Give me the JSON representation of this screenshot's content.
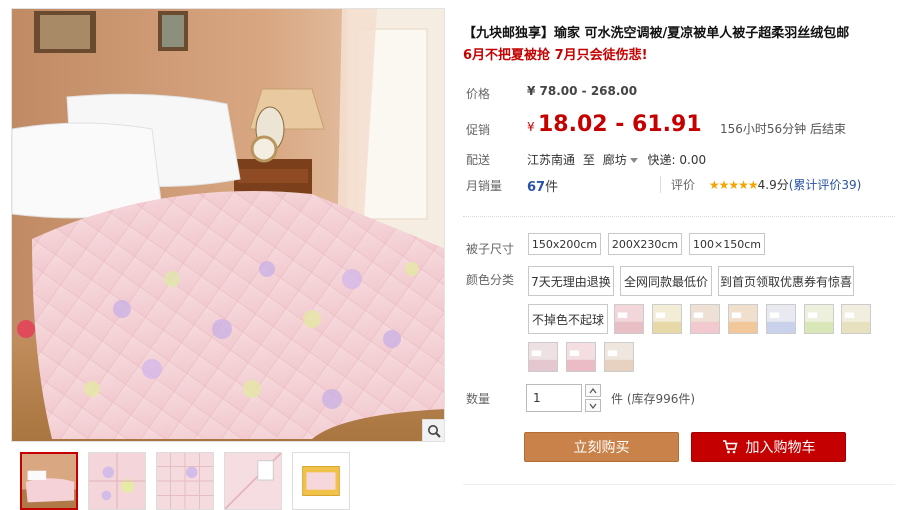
{
  "product": {
    "title": "【九块邮独享】瑜家 可水洗空调被/夏凉被单人被子超柔羽丝绒包邮",
    "subtitle": "6月不把夏被抢 7月只会徒伤悲!"
  },
  "price": {
    "label": "价格",
    "original": "¥ 78.00 - 268.00"
  },
  "promo": {
    "label": "促销",
    "currency": "¥",
    "price": "18.02 - 61.91",
    "timer": "156小时56分钟 后结束"
  },
  "shipping": {
    "label": "配送",
    "from": "江苏南通",
    "to_label": "至",
    "to": "廊坊",
    "fee": "快递: 0.00"
  },
  "sales": {
    "label": "月销量",
    "count": "67",
    "unit": "件"
  },
  "rating": {
    "label": "评价",
    "stars": "★★★★★",
    "score": "4.9分",
    "count": "(累计评价39)"
  },
  "size": {
    "label": "被子尺寸",
    "options": [
      "150x200cm",
      "200X230cm",
      "100×150cm"
    ]
  },
  "color": {
    "label": "颜色分类",
    "options": [
      "7天无理由退换",
      "全网同款最低价",
      "到首页领取优惠券有惊喜",
      "不掉色不起球"
    ],
    "swatch_count": 10
  },
  "quantity": {
    "label": "数量",
    "value": "1",
    "unit": "件",
    "stock": "(库存996件)"
  },
  "actions": {
    "buy_now": "立刻购买",
    "add_to_cart": "加入购物车"
  },
  "colors": {
    "accent_red": "#c40000",
    "buy_orange": "#c9824a",
    "link_blue": "#2953a6",
    "star_gold": "#f5a400"
  }
}
